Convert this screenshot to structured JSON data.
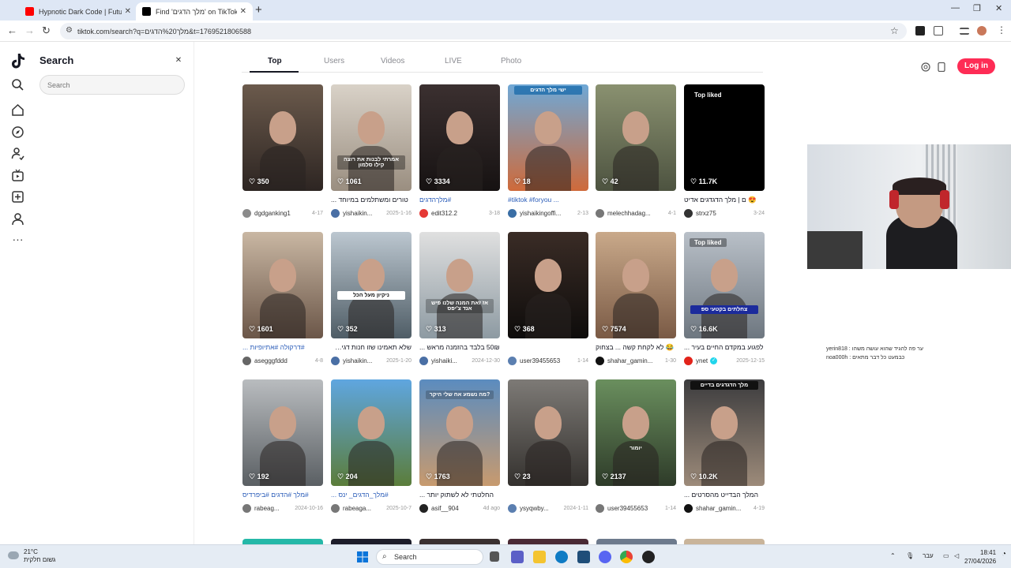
{
  "browser": {
    "tabs": [
      {
        "title": "Hypnotic Dark Code | Futuristic",
        "color": "#ff0000"
      },
      {
        "title": "Find 'מלך הדגים' on TikTok | Ti",
        "color": "#000000"
      }
    ],
    "url": "tiktok.com/search?q=מלך%20הדגים&t=1769521806588"
  },
  "sidebar": {
    "title": "Search",
    "search_placeholder": "Search"
  },
  "tabs": [
    "Top",
    "Users",
    "Videos",
    "LIVE",
    "Photo"
  ],
  "login_label": "Log in",
  "videos": [
    {
      "likes": "350",
      "desc": "",
      "user": "dgdganking1",
      "date": "4-17",
      "badge": ""
    },
    {
      "likes": "1061",
      "desc": "טורים ומשתלמים במיוחד ...",
      "user": "yishaikin...",
      "date": "2025-1-16",
      "badge": ""
    },
    {
      "likes": "3334",
      "desc": "#מלךהדגים",
      "user": "edit312.2",
      "date": "3-18",
      "badge": ""
    },
    {
      "likes": "18",
      "desc": "#tiktok #foryou ...",
      "user": "yishaikingoffi...",
      "date": "2-13",
      "badge": ""
    },
    {
      "likes": "42",
      "desc": "",
      "user": "melechhadag...",
      "date": "4-1",
      "badge": ""
    },
    {
      "likes": "11.7K",
      "desc": "😍 ם | מלך הדגדגים אדיט",
      "user": "strxz75",
      "date": "3-24",
      "badge": "Top liked"
    },
    {
      "likes": "1601",
      "desc": "#דרקולה #אתיופיות ...",
      "user": "asegggfddd",
      "date": "4-8",
      "badge": ""
    },
    {
      "likes": "352",
      "desc": "שלא תאמינו שזו חנות דגים ...",
      "user": "yishaikin...",
      "date": "2025-1-20",
      "badge": ""
    },
    {
      "likes": "313",
      "desc": "50₪ בלבד בהזמנה מראש ...",
      "user": "yishaiki...",
      "date": "2024-12-30",
      "badge": ""
    },
    {
      "likes": "368",
      "desc": "",
      "user": "user39455653",
      "date": "1-14",
      "badge": ""
    },
    {
      "likes": "7574",
      "desc": "😂 לא לקחת קשה ... בצחוק",
      "user": "shahar_gamin...",
      "date": "1-30",
      "badge": ""
    },
    {
      "likes": "16.6K",
      "desc": "לפגוע במקדם החיים בעיר ...",
      "user": "ynet",
      "date": "2025-12-15",
      "badge": "Top liked"
    },
    {
      "likes": "192",
      "desc": "#מלך #הדגים #ביפרדיס",
      "user": "rabeag...",
      "date": "2024-10-16",
      "badge": ""
    },
    {
      "likes": "204",
      "desc": "#מלך_הדגים_ ינס ...",
      "user": "rabeaga...",
      "date": "2025-10-7",
      "badge": ""
    },
    {
      "likes": "1763",
      "desc": "החלטתי לא לשתוק יותר ...",
      "user": "asif__904",
      "date": "4d ago",
      "badge": ""
    },
    {
      "likes": "23",
      "desc": "",
      "user": "ysyqwby...",
      "date": "2024-1-11",
      "badge": ""
    },
    {
      "likes": "2137",
      "desc": "",
      "user": "user39455653",
      "date": "1-14",
      "badge": ""
    },
    {
      "likes": "10.2K",
      "desc": "המלך הבדייט מהסרטים ...",
      "user": "shahar_gamin...",
      "date": "4-19",
      "badge": ""
    }
  ],
  "captions": {
    "c2": "אמרתי לבנות את רוצה קילו סלמון",
    "c3": "",
    "c4": "ישי מלך הדגים",
    "c8": "ניקיון מעל הכל",
    "c9": "אז זאת המנה שלנו פיש אנד צ'יפס",
    "c12": "צחלתים בקטעי ספ",
    "c15": "מה נשמע אח שלי היקר?",
    "c17": "יומור",
    "c18": "מלך הדגדגים בדיים"
  },
  "taskbar": {
    "weather_temp": "21°C",
    "weather_desc": "גשום חלקית",
    "search_label": "Search",
    "lang": "עבר",
    "time": "18:41",
    "date": "27/04/2026"
  },
  "chat": {
    "line1": "yerin818 : ער פה להגיד שהוא עושה משהו",
    "line2": "noa000h : כבמעט כל דבר מתאים"
  }
}
